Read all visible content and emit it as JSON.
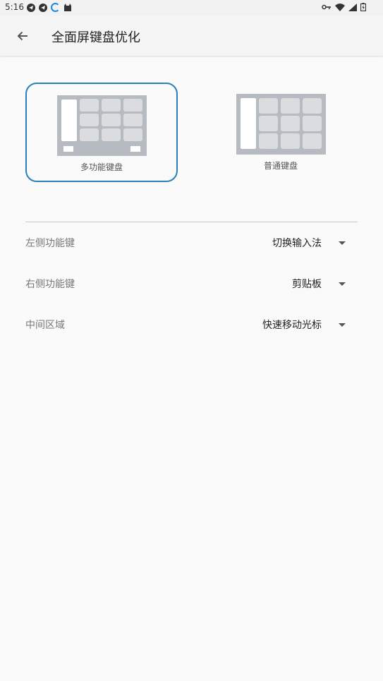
{
  "status_bar": {
    "time": "5:16",
    "left_icons": [
      "telegram-icon",
      "telegram-icon",
      "sync-icon",
      "cat-icon"
    ],
    "right_icons": [
      "vpn-key-icon",
      "wifi-icon",
      "signal-icon",
      "battery-icon"
    ]
  },
  "toolbar": {
    "title": "全面屏键盘优化",
    "back_icon": "arrow-left-icon"
  },
  "keyboard_options": [
    {
      "label": "多功能键盘",
      "selected": true
    },
    {
      "label": "普通键盘",
      "selected": false
    }
  ],
  "settings": [
    {
      "label": "左侧功能键",
      "value": "切换输入法"
    },
    {
      "label": "右侧功能键",
      "value": "剪贴板"
    },
    {
      "label": "中间区域",
      "value": "快速移动光标"
    }
  ],
  "colors": {
    "accent": "#2a7fb8",
    "keyboard_bg": "#b6bac1",
    "key": "#dadcdf"
  }
}
